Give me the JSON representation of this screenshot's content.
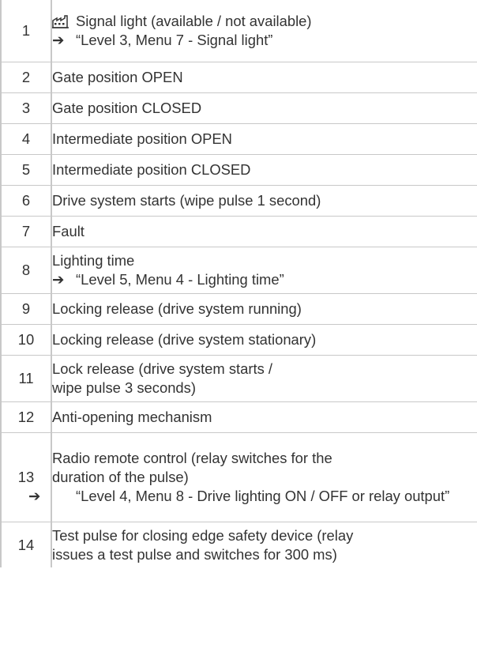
{
  "arrow_symbol": "➔",
  "rows": [
    {
      "num": "1",
      "text": "Signal light (available / not available)",
      "ref": "“Level 3, Menu 7 - Signal light”",
      "icon": "factory-setting-icon"
    },
    {
      "num": "2",
      "text": "Gate position OPEN"
    },
    {
      "num": "3",
      "text": "Gate position CLOSED"
    },
    {
      "num": "4",
      "text": "Intermediate position OPEN"
    },
    {
      "num": "5",
      "text": "Intermediate position CLOSED"
    },
    {
      "num": "6",
      "text": "Drive system starts (wipe pulse 1 second)"
    },
    {
      "num": "7",
      "text": "Fault"
    },
    {
      "num": "8",
      "text": "Lighting time",
      "ref": "“Level 5, Menu 4 - Lighting time”"
    },
    {
      "num": "9",
      "text": "Locking release (drive system running)"
    },
    {
      "num": "10",
      "text": "Locking release (drive system stationary)"
    },
    {
      "num": "11",
      "text_lines": [
        "Lock release (drive system starts /",
        "wipe pulse 3 seconds)"
      ]
    },
    {
      "num": "12",
      "text": "Anti-opening mechanism"
    },
    {
      "num": "13",
      "text_lines": [
        "Radio remote control (relay switches for the",
        "duration of the pulse)"
      ],
      "ref": "“Level 4, Menu 8 - Drive lighting ON / OFF or relay output”"
    },
    {
      "num": "14",
      "text_lines": [
        "Test pulse for closing edge safety device (relay",
        "issues a test pulse and switches for 300 ms)"
      ]
    }
  ]
}
